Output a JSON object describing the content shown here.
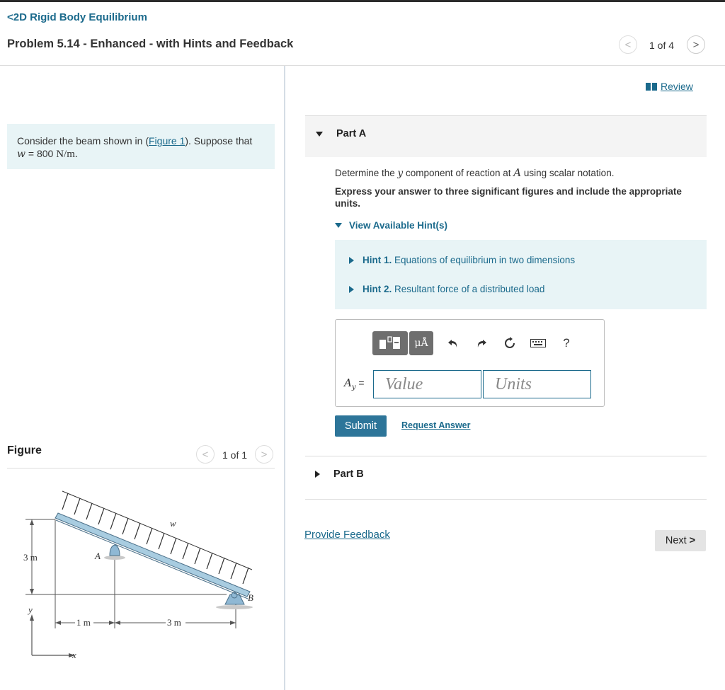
{
  "header": {
    "breadcrumb": "2D Rigid Body Equilibrium",
    "problem_title": "Problem 5.14 - Enhanced - with Hints and Feedback",
    "pager": "1 of 4"
  },
  "review_label": "Review",
  "problem": {
    "text_before": "Consider the beam shown in (",
    "link": "Figure 1",
    "text_after": "). Suppose that",
    "w_symbol": "w",
    "w_value": " = 800 ",
    "w_units": "N/m."
  },
  "figure": {
    "label": "Figure",
    "pager": "1 of 1",
    "labels": {
      "w": "w",
      "A": "A",
      "B": "B",
      "dim_3m_vertical": "3 m",
      "dim_1m": "1 m",
      "dim_3m_horizontal": "3 m",
      "axis_y": "y",
      "axis_x": "x"
    }
  },
  "partA": {
    "label": "Part A",
    "question_pre": "Determine the ",
    "question_y": "y",
    "question_mid": " component of reaction at ",
    "question_A": "A",
    "question_post": "  using scalar notation.",
    "instructions": "Express your answer to three significant figures and include the appropriate units.",
    "hints_toggle": "View Available Hint(s)",
    "hints": [
      {
        "num": "Hint 1.",
        "text": " Equations of equilibrium in two dimensions"
      },
      {
        "num": "Hint 2.",
        "text": " Resultant force of a distributed load"
      }
    ],
    "toolbar": {
      "mu_label": "μÅ",
      "help_label": "?"
    },
    "answer_var": "A",
    "answer_sub": "y",
    "answer_eq": " =",
    "value_placeholder": "Value",
    "units_placeholder": "Units",
    "submit_label": "Submit",
    "request_label": "Request Answer"
  },
  "partB": {
    "label": "Part B"
  },
  "feedback_label": "Provide Feedback",
  "next_label": "Next"
}
